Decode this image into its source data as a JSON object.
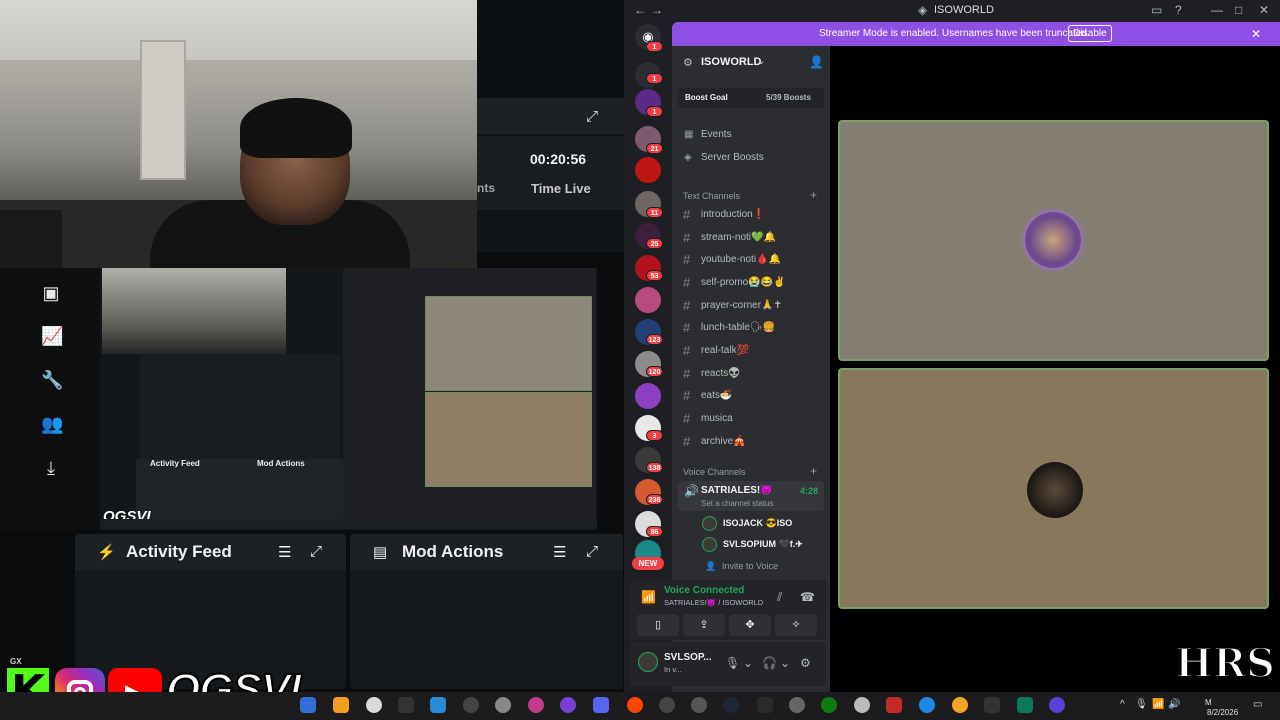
{
  "stats": {
    "time_live_value": "00:20:56",
    "time_live_label": "Time Live",
    "partial_label": "nts"
  },
  "cards": {
    "activity_title": "Activity Feed",
    "mod_title": "Mod Actions"
  },
  "preview": {
    "activity_title": "Activity Feed",
    "mod_title": "Mod Actions",
    "brand": "OGSVL"
  },
  "brand": {
    "name": "OGSVL",
    "gx": "GX",
    "kick_letter": "K"
  },
  "discord": {
    "window_title": "ISOWORLD",
    "streamer_banner": "Streamer Mode is enabled. Usernames have been truncated.",
    "disable_label": "Disable",
    "server_name": "ISOWORLD",
    "boost_label": "Boost Goal",
    "boost_count": "5/39 Boosts",
    "nav": [
      "Events",
      "Server Boosts"
    ],
    "text_channels_header": "Text Channels",
    "text_channels": [
      "introduction❗",
      "stream-noti💚🔔",
      "youtube-noti🩸🔔",
      "self-promo😭😂✌",
      "prayer-corner🙏✝",
      "lunch-table🗣🍔",
      "real-talk💯",
      "reacts👽",
      "eats🍜",
      "musica",
      "archive🎪"
    ],
    "voice_channels_header": "Voice Channels",
    "voice_channel": {
      "name": "SATRIALES!😈",
      "status": "Set a channel status",
      "timer": "4:28"
    },
    "voice_users": [
      "ISOJACK 😎ISO",
      "SVLSOPIUM 🖤f.✈"
    ],
    "invite": "Invite to Voice",
    "voice_connected": "Voice Connected",
    "voice_connected_sub": "SATRIALES!😈 / ISOWORLD",
    "user_name": "SVLSOP...",
    "user_status": "In v...",
    "new_badge": "NEW",
    "server_badges": [
      "1",
      "1",
      "1",
      "",
      "21",
      "",
      "",
      "11",
      "25",
      "53",
      "",
      "123",
      "120",
      "",
      "3",
      "138",
      "236",
      "86"
    ]
  },
  "taskbar": {
    "time": "M",
    "date": "8/2/2026"
  },
  "logo": {
    "hrs": "HRS"
  },
  "colors": {
    "accent": "#8f4fe5",
    "green": "#23a55a",
    "red": "#f23f43",
    "kick": "#53fc18"
  }
}
